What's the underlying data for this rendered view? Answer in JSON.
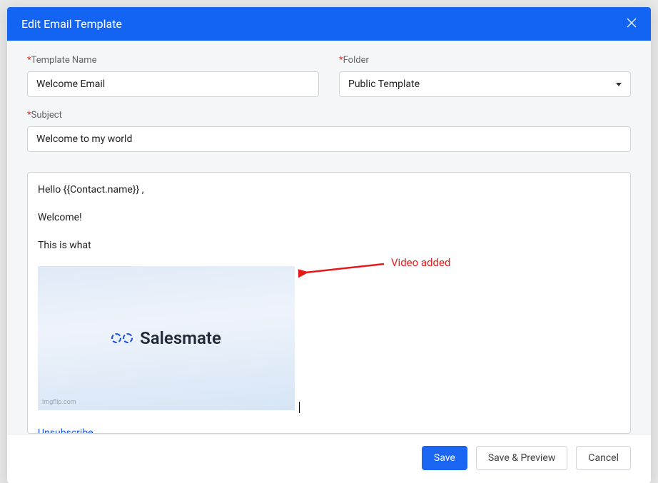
{
  "modal": {
    "title": "Edit Email Template",
    "fields": {
      "template_name": {
        "label": "Template Name",
        "value": "Welcome Email"
      },
      "folder": {
        "label": "Folder",
        "value": "Public Template"
      },
      "subject": {
        "label": "Subject",
        "value": "Welcome to my world"
      }
    }
  },
  "editor": {
    "line1": "Hello {{Contact.name}} ,",
    "line2": "Welcome!",
    "line3": "This is what",
    "video_logo_text": "Salesmate",
    "watermark": "imgflip.com",
    "unsubscribe": "Unsubscribe"
  },
  "annotation": {
    "text": "Video added"
  },
  "footer": {
    "save": "Save",
    "save_preview": "Save & Preview",
    "cancel": "Cancel"
  }
}
